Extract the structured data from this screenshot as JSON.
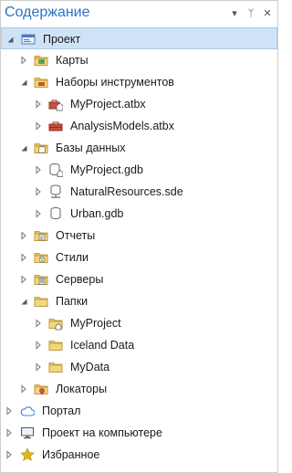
{
  "panel": {
    "title": "Содержание",
    "menu_glyph": "▾",
    "pin_glyph": "ᛘ",
    "close_glyph": "✕"
  },
  "tree": [
    {
      "id": "project",
      "label": "Проект",
      "level": 0,
      "expanded": true,
      "selected": true,
      "icon": "project-folder-icon"
    },
    {
      "id": "maps",
      "label": "Карты",
      "level": 1,
      "expanded": false,
      "icon": "maps-folder-icon"
    },
    {
      "id": "toolboxes",
      "label": "Наборы инструментов",
      "level": 1,
      "expanded": true,
      "icon": "toolbox-folder-icon"
    },
    {
      "id": "myproject-atbx",
      "label": "MyProject.atbx",
      "level": 2,
      "expanded": false,
      "icon": "toolbox-home-icon"
    },
    {
      "id": "analysismodels-atbx",
      "label": "AnalysisModels.atbx",
      "level": 2,
      "expanded": false,
      "icon": "toolbox-icon"
    },
    {
      "id": "databases",
      "label": "Базы данных",
      "level": 1,
      "expanded": true,
      "icon": "database-folder-icon"
    },
    {
      "id": "myproject-gdb",
      "label": "MyProject.gdb",
      "level": 2,
      "expanded": false,
      "icon": "geodatabase-home-icon"
    },
    {
      "id": "naturalresources-sde",
      "label": "NaturalResources.sde",
      "level": 2,
      "expanded": false,
      "icon": "enterprise-database-icon"
    },
    {
      "id": "urban-gdb",
      "label": "Urban.gdb",
      "level": 2,
      "expanded": false,
      "icon": "geodatabase-icon"
    },
    {
      "id": "reports",
      "label": "Отчеты",
      "level": 1,
      "expanded": false,
      "icon": "reports-folder-icon"
    },
    {
      "id": "styles",
      "label": "Стили",
      "level": 1,
      "expanded": false,
      "icon": "styles-folder-icon"
    },
    {
      "id": "servers",
      "label": "Серверы",
      "level": 1,
      "expanded": false,
      "icon": "servers-folder-icon"
    },
    {
      "id": "folders",
      "label": "Папки",
      "level": 1,
      "expanded": true,
      "icon": "folders-folder-icon"
    },
    {
      "id": "myproject-folder",
      "label": "MyProject",
      "level": 2,
      "expanded": false,
      "icon": "home-folder-icon"
    },
    {
      "id": "iceland-data",
      "label": "Iceland Data",
      "level": 2,
      "expanded": false,
      "icon": "folder-icon"
    },
    {
      "id": "mydata",
      "label": "MyData",
      "level": 2,
      "expanded": false,
      "icon": "folder-icon"
    },
    {
      "id": "locators",
      "label": "Локаторы",
      "level": 1,
      "expanded": false,
      "icon": "locators-folder-icon"
    },
    {
      "id": "portal",
      "label": "Портал",
      "level": 0,
      "expanded": false,
      "icon": "portal-cloud-icon"
    },
    {
      "id": "computer",
      "label": "Проект на компьютере",
      "level": 0,
      "expanded": false,
      "icon": "computer-icon"
    },
    {
      "id": "favorites",
      "label": "Избранное",
      "level": 0,
      "expanded": false,
      "icon": "favorites-star-icon"
    }
  ],
  "colors": {
    "accent": "#2b73c8",
    "selection_bg": "#cfe3f7",
    "folder_yellow": "#e8c25a",
    "toolbox_red": "#c8503a",
    "star_gold": "#e2b21c",
    "cloud_blue": "#3a86d4"
  }
}
